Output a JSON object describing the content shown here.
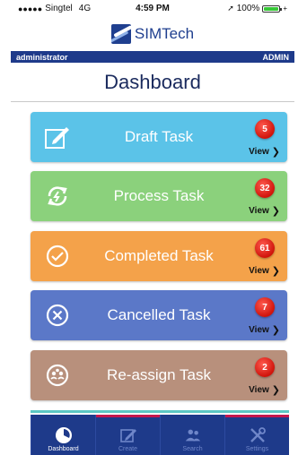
{
  "status_bar": {
    "carrier": "Singtel",
    "network": "4G",
    "time": "4:59 PM",
    "battery": "100%",
    "battery_level": 1.0
  },
  "brand": {
    "name": "SIMTech"
  },
  "user_bar": {
    "username": "administrator",
    "role": "ADMIN"
  },
  "page": {
    "title": "Dashboard"
  },
  "tiles": [
    {
      "label": "Draft Task",
      "count": "5",
      "view_label": "View",
      "color": "#5bc3e8",
      "icon": "edit-icon"
    },
    {
      "label": "Process Task",
      "count": "32",
      "view_label": "View",
      "color": "#8bd17c",
      "icon": "sync-icon"
    },
    {
      "label": "Completed Task",
      "count": "61",
      "view_label": "View",
      "color": "#f4a24a",
      "icon": "check-circle-icon"
    },
    {
      "label": "Cancelled Task",
      "count": "7",
      "view_label": "View",
      "color": "#5b78c8",
      "icon": "x-circle-icon"
    },
    {
      "label": "Re-assign Task",
      "count": "2",
      "view_label": "View",
      "color": "#b8907c",
      "icon": "reassign-icon"
    }
  ],
  "tab_bar": {
    "tabs": [
      {
        "label": "Dashboard",
        "icon": "clock-icon",
        "active": true,
        "accent": "#1e3a8a"
      },
      {
        "label": "Create",
        "icon": "create-icon",
        "active": false,
        "accent": "#c4174d"
      },
      {
        "label": "Search",
        "icon": "people-icon",
        "active": false,
        "accent": "#1e3a8a"
      },
      {
        "label": "Settings",
        "icon": "tools-icon",
        "active": false,
        "accent": "#c4174d"
      }
    ]
  }
}
